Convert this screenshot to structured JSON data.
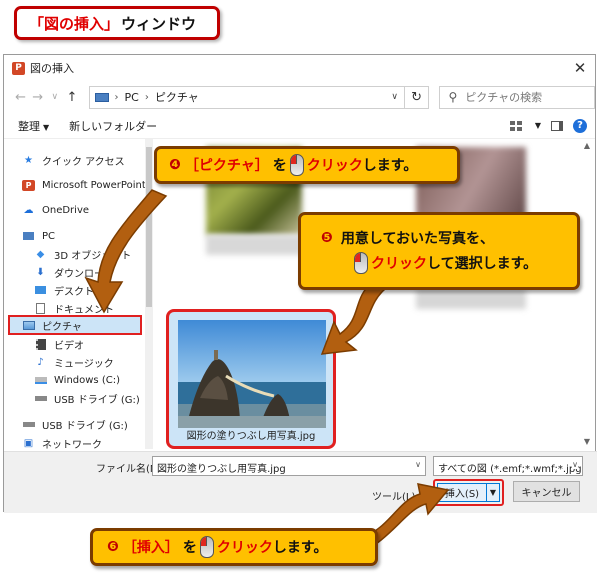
{
  "header": {
    "title_red": "「図の挿入」",
    "title_black": "ウィンドウ"
  },
  "dialog": {
    "title": "図の挿入",
    "close": "✕",
    "nav": {
      "back": "←",
      "forward": "→",
      "recent": "∨",
      "up": "↑"
    },
    "address": {
      "crumbs": [
        "PC",
        "ピクチャ"
      ],
      "dropdown": "∨",
      "refresh": "↻"
    },
    "search": {
      "icon": "⚲",
      "placeholder": "ピクチャの検索"
    },
    "toolbar": {
      "organize": "整理",
      "new_folder": "新しいフォルダー",
      "help": "?"
    },
    "sidebar": {
      "items": [
        {
          "label": "クイック アクセス",
          "icon": "star-icon"
        },
        {
          "label": "Microsoft PowerPoint",
          "icon": "powerpoint-icon"
        },
        {
          "label": "OneDrive",
          "icon": "cloud-icon"
        },
        {
          "label": "PC",
          "icon": "pc-icon"
        },
        {
          "label": "3D オブジェクト",
          "icon": "cube-icon"
        },
        {
          "label": "ダウンロード",
          "icon": "download-icon"
        },
        {
          "label": "デスクトップ",
          "icon": "desktop-icon"
        },
        {
          "label": "ドキュメント",
          "icon": "document-icon"
        },
        {
          "label": "ピクチャ",
          "icon": "pictures-icon"
        },
        {
          "label": "ビデオ",
          "icon": "video-icon"
        },
        {
          "label": "ミュージック",
          "icon": "music-icon"
        },
        {
          "label": "Windows (C:)",
          "icon": "drive-icon"
        },
        {
          "label": "USB ドライブ (G:)",
          "icon": "usb-icon"
        },
        {
          "label": "USB ドライブ (G:)",
          "icon": "usb-icon"
        },
        {
          "label": "ネットワーク",
          "icon": "network-icon"
        }
      ]
    },
    "selected_file": {
      "caption": "図形の塗りつぶし用写真.jpg"
    },
    "bottom": {
      "filename_label": "ファイル名(N):",
      "filename_value": "図形の塗りつぶし用写真.jpg",
      "filter_value": "すべての図 (*.emf;*.wmf;*.jpg;*.jp",
      "tools_label": "ツール(L)",
      "insert_label": "挿入(S)",
      "cancel_label": "キャンセル"
    }
  },
  "callouts": {
    "c4": {
      "num": "❹",
      "bracket_text": "［ピクチャ］",
      "mid": "を",
      "click": "クリック",
      "rest": "します。"
    },
    "c5": {
      "num": "❺",
      "line1": "用意しておいた写真を、",
      "click": "クリック",
      "rest": "して選択します。"
    },
    "c6": {
      "num": "❻",
      "bracket_text": "［挿入］",
      "mid": "を",
      "click": "クリック",
      "rest": "します。"
    }
  },
  "colors": {
    "callout_fill": "#ffc000",
    "callout_border": "#7b3c00",
    "highlight_red": "#e02020",
    "selection_blue": "#cce4f7"
  }
}
